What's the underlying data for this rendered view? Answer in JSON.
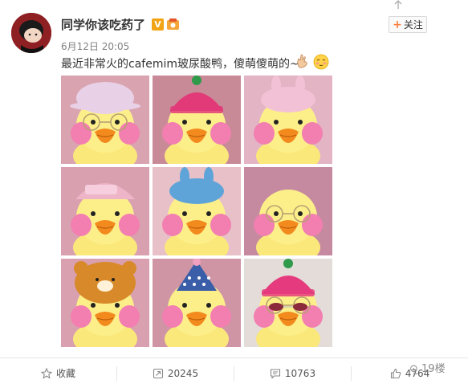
{
  "user": {
    "name": "同学你该吃药了",
    "verify_mark": "V"
  },
  "follow": {
    "plus": "+",
    "label": "关注"
  },
  "post": {
    "time": "6月12日 20:05",
    "text": "最近非常火的cafemim玻尿酸鸭，傻萌傻萌的~",
    "emojis": [
      "hand-emoji",
      "shy-face-emoji"
    ]
  },
  "images": [
    {
      "name": "duck-purple-hat-glasses",
      "bg": "#d9a3b0",
      "hat": "#e8d0e6"
    },
    {
      "name": "duck-pink-beanie",
      "bg": "#c98a98",
      "hat": "#e23a78"
    },
    {
      "name": "duck-pink-bunny-hat",
      "bg": "#e3b4c4",
      "hat": "#f3c1d6"
    },
    {
      "name": "duck-pink-cap",
      "bg": "#d9a0b0",
      "hat": "#eeb5c8"
    },
    {
      "name": "duck-blue-bunny-hat",
      "bg": "#e8c0c8",
      "hat": "#5fa4d8"
    },
    {
      "name": "duck-round-glasses",
      "bg": "#c68aa0",
      "hat": "none"
    },
    {
      "name": "duck-bear-hat",
      "bg": "#d9a0b0",
      "hat": "#d88a2a"
    },
    {
      "name": "duck-party-hat",
      "bg": "#cf95a5",
      "hat": "#3a5ea8"
    },
    {
      "name": "duck-beanie-sunglasses",
      "bg": "#e3dcd8",
      "hat": "#e53b7e"
    }
  ],
  "actions": {
    "favorite_label": "收藏",
    "repost_count": "20245",
    "comment_count": "10763",
    "like_count": "4764"
  },
  "watermark": "19楼",
  "colors": {
    "accent": "#ff8140",
    "text": "#333333",
    "muted": "#808080"
  }
}
